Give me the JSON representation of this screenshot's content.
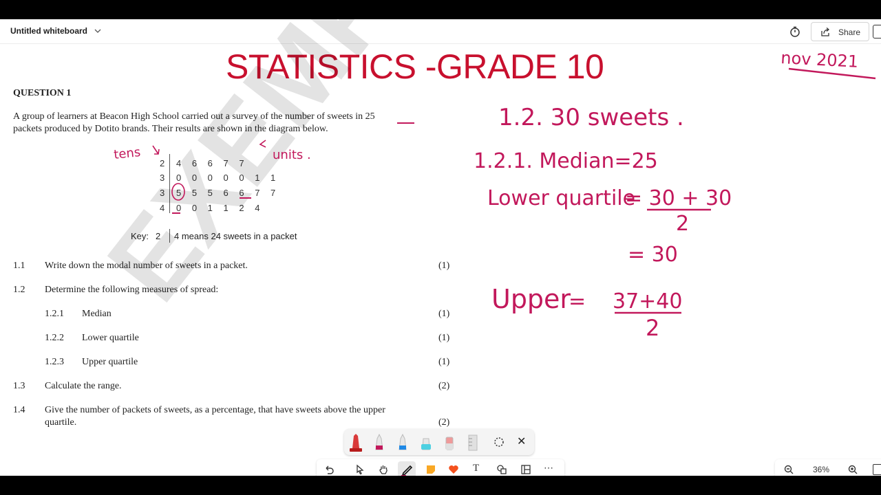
{
  "app": {
    "board_title": "Untitled whiteboard",
    "share_label": "Share",
    "zoom_level": "36%"
  },
  "canvas": {
    "title": "STATISTICS -GRADE 10",
    "date_note": "nov 2021",
    "question": {
      "heading": "QUESTION 1",
      "intro_line1": "A group of learners at Beacon High School carried out a survey of the number of sweets in 25",
      "intro_line2": "packets produced by Dotito brands. Their results are shown in the diagram below.",
      "stem_leaf": [
        {
          "stem": "2",
          "leaves": "4 6 6 7 7"
        },
        {
          "stem": "3",
          "leaves": "0 0 0 0 0 1 1"
        },
        {
          "stem": "3",
          "leaves": "5 5 5 6 6 7 7"
        },
        {
          "stem": "4",
          "leaves": "0 0 1 1 2 4"
        }
      ],
      "key_label": "Key:",
      "key_stem": "2",
      "key_text": "4 means 24 sweets in a packet",
      "watermark": "EXEMPLAR",
      "items": [
        {
          "num": "1.1",
          "text": "Write down the modal number of sweets in a packet.",
          "marks": "(1)"
        },
        {
          "num": "1.2",
          "text": "Determine the following measures of spread:",
          "marks": ""
        },
        {
          "num": "1.2.1",
          "text": "Median",
          "marks": "(1)"
        },
        {
          "num": "1.2.2",
          "text": "Lower quartile",
          "marks": "(1)"
        },
        {
          "num": "1.2.3",
          "text": "Upper quartile",
          "marks": "(1)"
        },
        {
          "num": "1.3",
          "text": "Calculate the range.",
          "marks": "(2)"
        },
        {
          "num": "1.4",
          "text": "Give the number of packets of sweets, as a percentage, that have sweets above the upper",
          "text2": "quartile.",
          "marks": "(2)"
        }
      ]
    },
    "annotations": {
      "tens": "tens",
      "units": "units .",
      "answer_1_2": "1.2.  30  sweets .",
      "median": "1.2.1. Median=25",
      "lower_label": "Lower quartile",
      "lower_eq": "= 30 + 30",
      "lower_den": "2",
      "lower_res": "= 30",
      "upper_label": "Upper",
      "upper_eq": "=",
      "upper_num": "37+40",
      "upper_den": "2"
    }
  },
  "colors": {
    "title_red": "#c8102e",
    "ink_magenta": "#c2185b"
  }
}
